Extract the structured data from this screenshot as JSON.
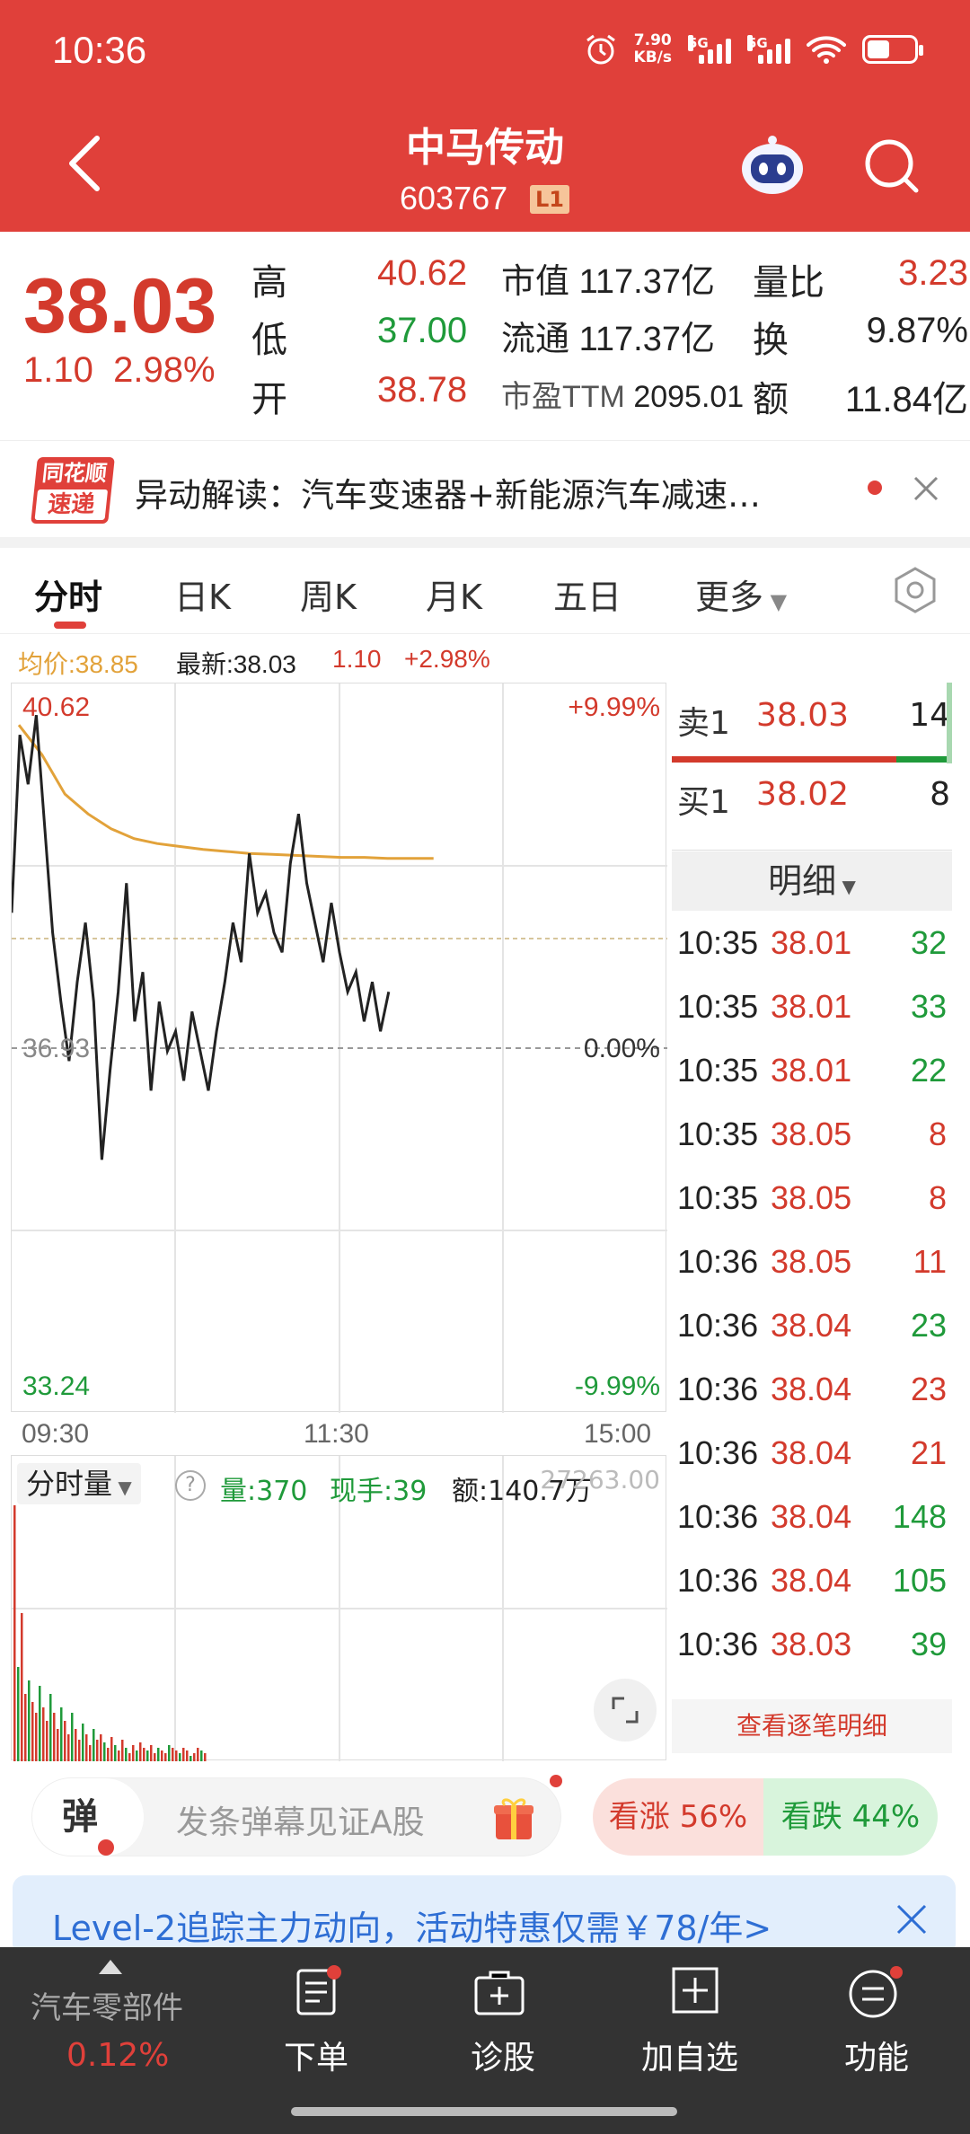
{
  "status": {
    "time": "10:36",
    "net_top": "7.90",
    "net_bottom": "KB/s",
    "sig1": "5G",
    "sig2": "5G"
  },
  "header": {
    "name": "中马传动",
    "code": "603767",
    "level": "L1"
  },
  "quote": {
    "price": "38.03",
    "change": "1.10",
    "pct": "2.98%",
    "high_label": "高",
    "high": "40.62",
    "low_label": "低",
    "low": "37.00",
    "open_label": "开",
    "open": "38.78",
    "mcap_label": "市值",
    "mcap": "117.37亿",
    "float_label": "流通",
    "float": "117.37亿",
    "pe_label": "市盈TTM",
    "pe": "2095.01",
    "vr_label": "量比",
    "vr": "3.23",
    "turn_label": "换",
    "turn": "9.87%",
    "amt_label": "额",
    "amt": "11.84亿"
  },
  "news": {
    "logo1": "同花顺",
    "logo2": "速递",
    "text": "异动解读：汽车变速器+新能源汽车减速…"
  },
  "tabs": [
    "分时",
    "日K",
    "周K",
    "月K",
    "五日",
    "更多"
  ],
  "info": {
    "avg": "均价:38.85",
    "latest": "最新:38.03",
    "chg": "1.10",
    "pct": "+2.98%"
  },
  "chart": {
    "ymax": "40.62",
    "ymid": "36.93",
    "ymin": "33.24",
    "pmax": "+9.99%",
    "pmid": "0.00%",
    "pmin": "-9.99%",
    "t0": "09:30",
    "t1": "11:30",
    "t2": "15:00",
    "price": [
      38.3,
      40.1,
      39.6,
      40.3,
      39.2,
      38.1,
      37.4,
      36.8,
      37.6,
      38.2,
      37.4,
      35.8,
      36.7,
      37.5,
      38.6,
      37.2,
      37.7,
      36.5,
      37.4,
      36.9,
      37.1,
      36.6,
      37.3,
      36.9,
      36.5,
      37.1,
      37.6,
      38.2,
      37.8,
      38.9,
      38.3,
      38.5,
      38.1,
      37.9,
      38.8,
      39.3,
      38.6,
      38.2,
      37.8,
      38.4,
      37.9,
      37.5,
      37.7,
      37.2,
      37.6,
      37.1,
      37.5
    ],
    "avg": [
      40.2,
      39.9,
      39.5,
      39.3,
      39.15,
      39.05,
      39.0,
      38.97,
      38.94,
      38.92,
      38.9,
      38.89,
      38.88,
      38.87,
      38.86,
      38.86,
      38.85,
      38.85,
      38.85
    ]
  },
  "volume": {
    "selector": "分时量",
    "vol": "量:370",
    "hand": "现手:39",
    "amt": "额:140.7万",
    "maxval": "27263.00",
    "bars": [
      0.95,
      0.35,
      0.55,
      0.25,
      0.3,
      0.22,
      0.18,
      0.28,
      0.2,
      0.15,
      0.25,
      0.18,
      0.12,
      0.2,
      0.15,
      0.1,
      0.18,
      0.12,
      0.08,
      0.14,
      0.1,
      0.06,
      0.12,
      0.08,
      0.1,
      0.07,
      0.05,
      0.09,
      0.06,
      0.04,
      0.08,
      0.05,
      0.03,
      0.06,
      0.04,
      0.07,
      0.05,
      0.04,
      0.06,
      0.03,
      0.05,
      0.04,
      0.03,
      0.06,
      0.05,
      0.04,
      0.03,
      0.05,
      0.04,
      0.02,
      0.03,
      0.05,
      0.04,
      0.03
    ]
  },
  "orderbook": {
    "sell_label": "卖1",
    "sell_price": "38.03",
    "sell_qty": "14",
    "buy_label": "买1",
    "buy_price": "38.02",
    "buy_qty": "8",
    "detail": "明细"
  },
  "trades": [
    {
      "t": "10:35",
      "p": "38.01",
      "q": "32",
      "pc": "red",
      "qc": "green"
    },
    {
      "t": "10:35",
      "p": "38.01",
      "q": "33",
      "pc": "red",
      "qc": "green"
    },
    {
      "t": "10:35",
      "p": "38.01",
      "q": "22",
      "pc": "red",
      "qc": "green"
    },
    {
      "t": "10:35",
      "p": "38.05",
      "q": "8",
      "pc": "red",
      "qc": "red"
    },
    {
      "t": "10:35",
      "p": "38.05",
      "q": "8",
      "pc": "red",
      "qc": "red"
    },
    {
      "t": "10:36",
      "p": "38.05",
      "q": "11",
      "pc": "red",
      "qc": "red"
    },
    {
      "t": "10:36",
      "p": "38.04",
      "q": "23",
      "pc": "red",
      "qc": "green"
    },
    {
      "t": "10:36",
      "p": "38.04",
      "q": "23",
      "pc": "red",
      "qc": "red"
    },
    {
      "t": "10:36",
      "p": "38.04",
      "q": "21",
      "pc": "red",
      "qc": "red"
    },
    {
      "t": "10:36",
      "p": "38.04",
      "q": "148",
      "pc": "red",
      "qc": "green"
    },
    {
      "t": "10:36",
      "p": "38.04",
      "q": "105",
      "pc": "red",
      "qc": "green"
    },
    {
      "t": "10:36",
      "p": "38.03",
      "q": "39",
      "pc": "red",
      "qc": "green"
    }
  ],
  "trades_more": "查看逐笔明细",
  "danmu": {
    "icon": "弹",
    "placeholder": "发条弹幕见证A股",
    "up": "看涨 56%",
    "down": "看跌 44%"
  },
  "promo": {
    "text": "Level-2追踪主力动向，活动特惠仅需￥78/年>"
  },
  "bottom": {
    "sector": "汽车零部件",
    "sector_pct": "0.12%",
    "order": "下单",
    "diag": "诊股",
    "add": "加自选",
    "func": "功能"
  },
  "colors": {
    "red": "#e0403a",
    "price_red": "#d33a2c",
    "green": "#1f9a3a",
    "avg_line": "#e2a23a"
  }
}
